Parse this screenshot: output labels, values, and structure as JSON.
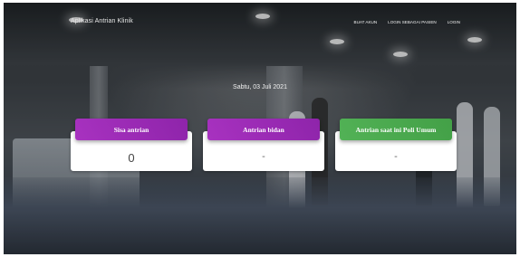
{
  "navbar": {
    "brand": "Aplikasi Antrian Klinik",
    "links": [
      "BUAT AKUN",
      "LOGIN SEBAGAI PASIEN",
      "LOGIN"
    ]
  },
  "date": "Sabtu, 03 Juli 2021",
  "cards": [
    {
      "title": "Sisa antrian",
      "value": "0",
      "color": "#9b27b0"
    },
    {
      "title": "Antrian bidan",
      "value": "-",
      "color": "#9b27b0"
    },
    {
      "title": "Antrian saat ini Poli Umum",
      "value": "-",
      "color": "#47a44b"
    }
  ],
  "colors": {
    "purple_header": "#9b27b0",
    "green_header": "#47a44b",
    "card_bg": "#ffffff"
  }
}
